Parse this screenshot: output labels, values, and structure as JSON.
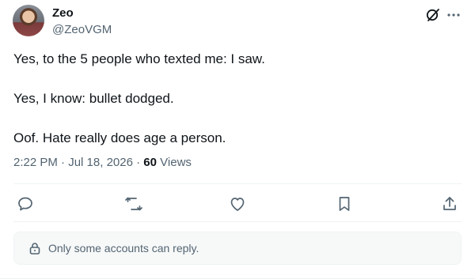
{
  "author": {
    "name": "Zeo",
    "handle": "@ZeoVGM"
  },
  "tweet": {
    "paragraphs": [
      "Yes, to the 5 people who texted me: I saw.",
      "Yes, I know: bullet dodged.",
      "Oof. Hate really does age a person."
    ],
    "time": "2:22 PM",
    "separator": "·",
    "date": "Jul 18, 2026",
    "views_count": "60",
    "views_label": "Views"
  },
  "icons": {
    "grok": "grok-icon",
    "more": "more-icon",
    "reply": "reply-icon",
    "retweet": "retweet-icon",
    "like": "heart-icon",
    "bookmark": "bookmark-icon",
    "share": "share-icon",
    "lock": "lock-icon"
  },
  "reply_restriction": {
    "text": "Only some accounts can reply."
  },
  "colors": {
    "text": "#0f1419",
    "secondary": "#536471",
    "divider": "#eff3f4"
  }
}
